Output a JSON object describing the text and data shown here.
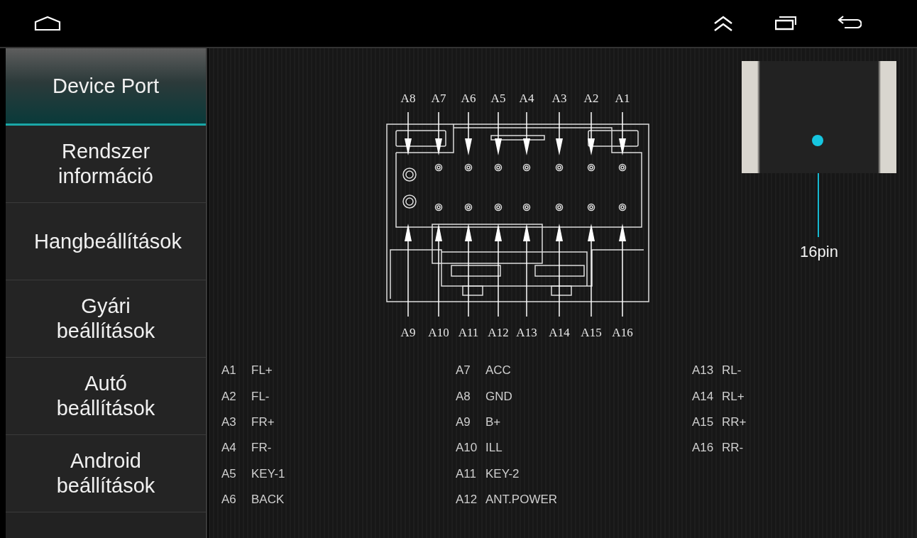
{
  "sidebar": {
    "items": [
      {
        "label": "Device Port",
        "selected": true
      },
      {
        "label": "Rendszer információ",
        "selected": false
      },
      {
        "label": "Hangbeállítások",
        "selected": false
      },
      {
        "label": "Gyári beállítások",
        "selected": false
      },
      {
        "label": "Autó beállítások",
        "selected": false
      },
      {
        "label": "Android beállítások",
        "selected": false
      }
    ]
  },
  "diagram": {
    "top_pins": [
      "A8",
      "A7",
      "A6",
      "A5",
      "A4",
      "A3",
      "A2",
      "A1"
    ],
    "bottom_pins": [
      "A9",
      "A10",
      "A11",
      "A12",
      "A13",
      "A14",
      "A15",
      "A16"
    ]
  },
  "photo_label": "16pin",
  "pin_columns": [
    [
      {
        "pin": "A1",
        "signal": "FL+"
      },
      {
        "pin": "A2",
        "signal": "FL-"
      },
      {
        "pin": "A3",
        "signal": "FR+"
      },
      {
        "pin": "A4",
        "signal": "FR-"
      },
      {
        "pin": "A5",
        "signal": "KEY-1"
      },
      {
        "pin": "A6",
        "signal": "BACK"
      }
    ],
    [
      {
        "pin": "A7",
        "signal": "ACC"
      },
      {
        "pin": "A8",
        "signal": "GND"
      },
      {
        "pin": "A9",
        "signal": "B+"
      },
      {
        "pin": "A10",
        "signal": "ILL"
      },
      {
        "pin": "A11",
        "signal": "KEY-2"
      },
      {
        "pin": "A12",
        "signal": "ANT.POWER"
      }
    ],
    [
      {
        "pin": "A13",
        "signal": "RL-"
      },
      {
        "pin": "A14",
        "signal": "RL+"
      },
      {
        "pin": "A15",
        "signal": "RR+"
      },
      {
        "pin": "A16",
        "signal": "RR-"
      }
    ]
  ]
}
